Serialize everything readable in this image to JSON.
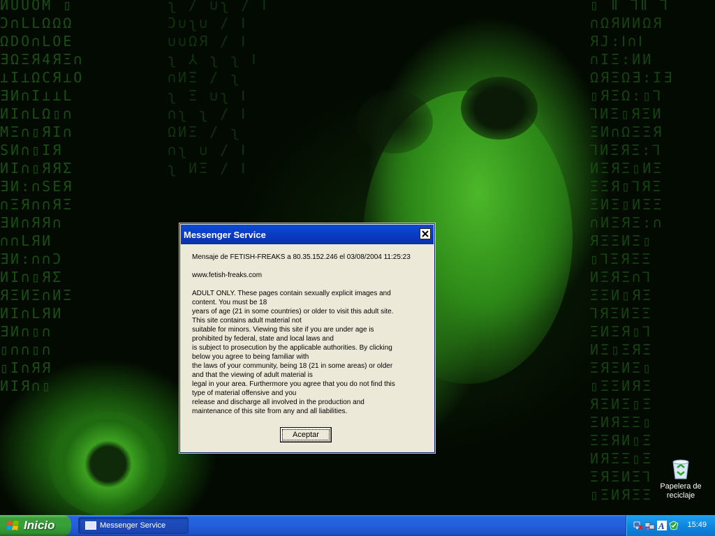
{
  "desktop": {
    "icons": [
      {
        "label": "Papelera de reciclaje",
        "icon": "recycle-bin-icon"
      }
    ]
  },
  "dialog": {
    "title": "Messenger Service",
    "message_lines": [
      "Mensaje de FETISH-FREAKS a 80.35.152.246 el 03/08/2004 11:25:23",
      "",
      "www.fetish-freaks.com",
      "",
      "ADULT ONLY. These pages contain sexually explicit images and",
      "content. You must be 18",
      "years of age (21 in some countries) or older to visit this adult site.",
      "This site contains adult material not",
      "suitable for minors. Viewing this site if you are under age is",
      "prohibited by federal, state and local laws and",
      "is subject to prosecution by the applicable authorities. By clicking",
      "below you agree to being familiar with",
      "the laws of your community, being 18 (21 in some areas) or older",
      "and that the viewing of adult material is",
      "legal in your area. Furthermore you agree that you do not find this",
      "type of material offensive and you",
      "release and discharge all involved in the production and",
      "maintenance of this site from any and all liabilities."
    ],
    "ok_label": "Aceptar"
  },
  "taskbar": {
    "start_label": "Inicio",
    "tasks": [
      {
        "label": "Messenger Service"
      }
    ],
    "clock": "15:49",
    "tray_icons": [
      "network-disconnected-icon",
      "network-icon",
      "font-icon",
      "antivirus-icon"
    ]
  },
  "colors": {
    "taskbar_blue": "#245edb",
    "start_green": "#37a037",
    "dialog_face": "#ece9d8",
    "title_blue": "#0a39c0",
    "wallpaper_green": "#3f9f22"
  }
}
